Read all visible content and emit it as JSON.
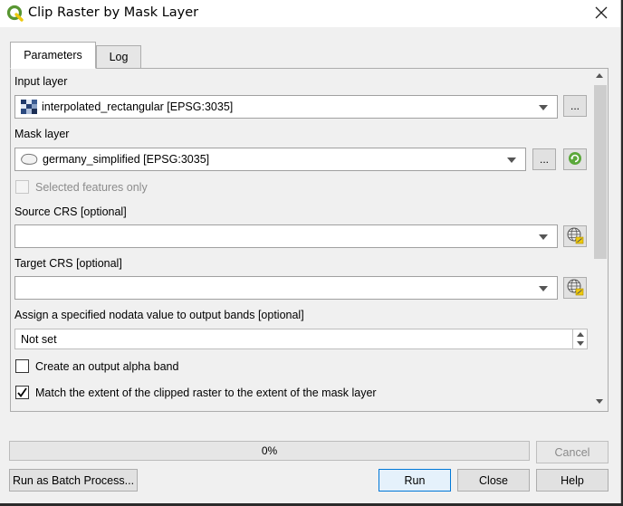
{
  "window": {
    "title": "Clip Raster by Mask Layer"
  },
  "tabs": [
    {
      "label": "Parameters"
    },
    {
      "label": "Log"
    }
  ],
  "params": {
    "input_layer": {
      "label": "Input layer",
      "value": "interpolated_rectangular [EPSG:3035]"
    },
    "mask_layer": {
      "label": "Mask layer",
      "value": "germany_simplified [EPSG:3035]"
    },
    "selected_only": {
      "label": "Selected features only",
      "checked": false,
      "enabled": false
    },
    "source_crs": {
      "label": "Source CRS [optional]",
      "value": ""
    },
    "target_crs": {
      "label": "Target CRS [optional]",
      "value": ""
    },
    "nodata": {
      "label": "Assign a specified nodata value to output bands [optional]",
      "value": "Not set"
    },
    "alpha_band": {
      "label": "Create an output alpha band",
      "checked": false
    },
    "match_extent": {
      "label": "Match the extent of the clipped raster to the extent of the mask layer",
      "checked": true
    },
    "ellipsis": "..."
  },
  "progress": {
    "value": 0,
    "text": "0%"
  },
  "buttons": {
    "cancel": "Cancel",
    "batch": "Run as Batch Process...",
    "run": "Run",
    "close": "Close",
    "help": "Help"
  },
  "colors": {
    "accent": "#0078d7",
    "qgis_green": "#589632",
    "qgis_yellow": "#eec90d"
  }
}
